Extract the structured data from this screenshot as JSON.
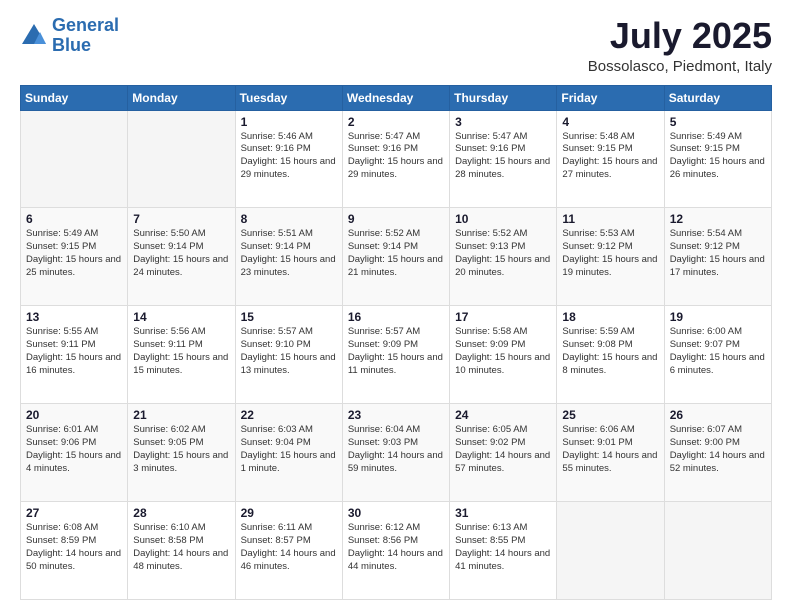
{
  "logo": {
    "line1": "General",
    "line2": "Blue"
  },
  "title": "July 2025",
  "subtitle": "Bossolasco, Piedmont, Italy",
  "days_of_week": [
    "Sunday",
    "Monday",
    "Tuesday",
    "Wednesday",
    "Thursday",
    "Friday",
    "Saturday"
  ],
  "weeks": [
    [
      {
        "day": "",
        "sunrise": "",
        "sunset": "",
        "daylight": ""
      },
      {
        "day": "",
        "sunrise": "",
        "sunset": "",
        "daylight": ""
      },
      {
        "day": "1",
        "sunrise": "Sunrise: 5:46 AM",
        "sunset": "Sunset: 9:16 PM",
        "daylight": "Daylight: 15 hours and 29 minutes."
      },
      {
        "day": "2",
        "sunrise": "Sunrise: 5:47 AM",
        "sunset": "Sunset: 9:16 PM",
        "daylight": "Daylight: 15 hours and 29 minutes."
      },
      {
        "day": "3",
        "sunrise": "Sunrise: 5:47 AM",
        "sunset": "Sunset: 9:16 PM",
        "daylight": "Daylight: 15 hours and 28 minutes."
      },
      {
        "day": "4",
        "sunrise": "Sunrise: 5:48 AM",
        "sunset": "Sunset: 9:15 PM",
        "daylight": "Daylight: 15 hours and 27 minutes."
      },
      {
        "day": "5",
        "sunrise": "Sunrise: 5:49 AM",
        "sunset": "Sunset: 9:15 PM",
        "daylight": "Daylight: 15 hours and 26 minutes."
      }
    ],
    [
      {
        "day": "6",
        "sunrise": "Sunrise: 5:49 AM",
        "sunset": "Sunset: 9:15 PM",
        "daylight": "Daylight: 15 hours and 25 minutes."
      },
      {
        "day": "7",
        "sunrise": "Sunrise: 5:50 AM",
        "sunset": "Sunset: 9:14 PM",
        "daylight": "Daylight: 15 hours and 24 minutes."
      },
      {
        "day": "8",
        "sunrise": "Sunrise: 5:51 AM",
        "sunset": "Sunset: 9:14 PM",
        "daylight": "Daylight: 15 hours and 23 minutes."
      },
      {
        "day": "9",
        "sunrise": "Sunrise: 5:52 AM",
        "sunset": "Sunset: 9:14 PM",
        "daylight": "Daylight: 15 hours and 21 minutes."
      },
      {
        "day": "10",
        "sunrise": "Sunrise: 5:52 AM",
        "sunset": "Sunset: 9:13 PM",
        "daylight": "Daylight: 15 hours and 20 minutes."
      },
      {
        "day": "11",
        "sunrise": "Sunrise: 5:53 AM",
        "sunset": "Sunset: 9:12 PM",
        "daylight": "Daylight: 15 hours and 19 minutes."
      },
      {
        "day": "12",
        "sunrise": "Sunrise: 5:54 AM",
        "sunset": "Sunset: 9:12 PM",
        "daylight": "Daylight: 15 hours and 17 minutes."
      }
    ],
    [
      {
        "day": "13",
        "sunrise": "Sunrise: 5:55 AM",
        "sunset": "Sunset: 9:11 PM",
        "daylight": "Daylight: 15 hours and 16 minutes."
      },
      {
        "day": "14",
        "sunrise": "Sunrise: 5:56 AM",
        "sunset": "Sunset: 9:11 PM",
        "daylight": "Daylight: 15 hours and 15 minutes."
      },
      {
        "day": "15",
        "sunrise": "Sunrise: 5:57 AM",
        "sunset": "Sunset: 9:10 PM",
        "daylight": "Daylight: 15 hours and 13 minutes."
      },
      {
        "day": "16",
        "sunrise": "Sunrise: 5:57 AM",
        "sunset": "Sunset: 9:09 PM",
        "daylight": "Daylight: 15 hours and 11 minutes."
      },
      {
        "day": "17",
        "sunrise": "Sunrise: 5:58 AM",
        "sunset": "Sunset: 9:09 PM",
        "daylight": "Daylight: 15 hours and 10 minutes."
      },
      {
        "day": "18",
        "sunrise": "Sunrise: 5:59 AM",
        "sunset": "Sunset: 9:08 PM",
        "daylight": "Daylight: 15 hours and 8 minutes."
      },
      {
        "day": "19",
        "sunrise": "Sunrise: 6:00 AM",
        "sunset": "Sunset: 9:07 PM",
        "daylight": "Daylight: 15 hours and 6 minutes."
      }
    ],
    [
      {
        "day": "20",
        "sunrise": "Sunrise: 6:01 AM",
        "sunset": "Sunset: 9:06 PM",
        "daylight": "Daylight: 15 hours and 4 minutes."
      },
      {
        "day": "21",
        "sunrise": "Sunrise: 6:02 AM",
        "sunset": "Sunset: 9:05 PM",
        "daylight": "Daylight: 15 hours and 3 minutes."
      },
      {
        "day": "22",
        "sunrise": "Sunrise: 6:03 AM",
        "sunset": "Sunset: 9:04 PM",
        "daylight": "Daylight: 15 hours and 1 minute."
      },
      {
        "day": "23",
        "sunrise": "Sunrise: 6:04 AM",
        "sunset": "Sunset: 9:03 PM",
        "daylight": "Daylight: 14 hours and 59 minutes."
      },
      {
        "day": "24",
        "sunrise": "Sunrise: 6:05 AM",
        "sunset": "Sunset: 9:02 PM",
        "daylight": "Daylight: 14 hours and 57 minutes."
      },
      {
        "day": "25",
        "sunrise": "Sunrise: 6:06 AM",
        "sunset": "Sunset: 9:01 PM",
        "daylight": "Daylight: 14 hours and 55 minutes."
      },
      {
        "day": "26",
        "sunrise": "Sunrise: 6:07 AM",
        "sunset": "Sunset: 9:00 PM",
        "daylight": "Daylight: 14 hours and 52 minutes."
      }
    ],
    [
      {
        "day": "27",
        "sunrise": "Sunrise: 6:08 AM",
        "sunset": "Sunset: 8:59 PM",
        "daylight": "Daylight: 14 hours and 50 minutes."
      },
      {
        "day": "28",
        "sunrise": "Sunrise: 6:10 AM",
        "sunset": "Sunset: 8:58 PM",
        "daylight": "Daylight: 14 hours and 48 minutes."
      },
      {
        "day": "29",
        "sunrise": "Sunrise: 6:11 AM",
        "sunset": "Sunset: 8:57 PM",
        "daylight": "Daylight: 14 hours and 46 minutes."
      },
      {
        "day": "30",
        "sunrise": "Sunrise: 6:12 AM",
        "sunset": "Sunset: 8:56 PM",
        "daylight": "Daylight: 14 hours and 44 minutes."
      },
      {
        "day": "31",
        "sunrise": "Sunrise: 6:13 AM",
        "sunset": "Sunset: 8:55 PM",
        "daylight": "Daylight: 14 hours and 41 minutes."
      },
      {
        "day": "",
        "sunrise": "",
        "sunset": "",
        "daylight": ""
      },
      {
        "day": "",
        "sunrise": "",
        "sunset": "",
        "daylight": ""
      }
    ]
  ]
}
